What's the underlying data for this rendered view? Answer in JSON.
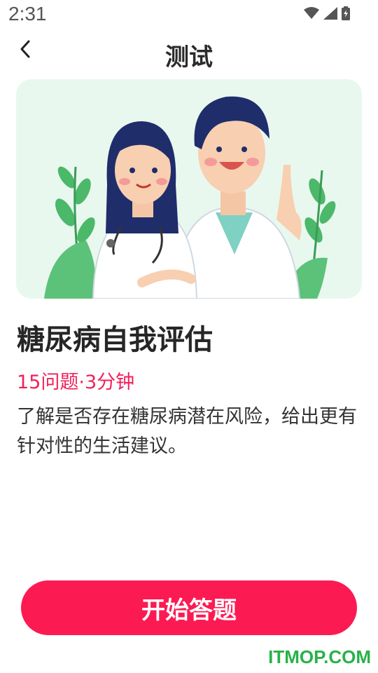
{
  "status_bar": {
    "time": "2:31",
    "icons": [
      "wifi-icon",
      "signal-icon",
      "battery-icon"
    ]
  },
  "nav": {
    "title": "测试",
    "back_icon": "chevron-left-icon"
  },
  "hero": {
    "illustration": "doctors-illustration",
    "background_color": "#e8f8ef"
  },
  "quiz": {
    "title": "糖尿病自我评估",
    "meta": "15问题·3分钟",
    "description": "了解是否存在糖尿病潜在风险，给出更有针对性的生活建议。"
  },
  "actions": {
    "start_label": "开始答题"
  },
  "watermark": "ITMOP.COM",
  "colors": {
    "accent": "#fc1a52",
    "meta_text": "#f0225c",
    "watermark": "#27b24a"
  }
}
